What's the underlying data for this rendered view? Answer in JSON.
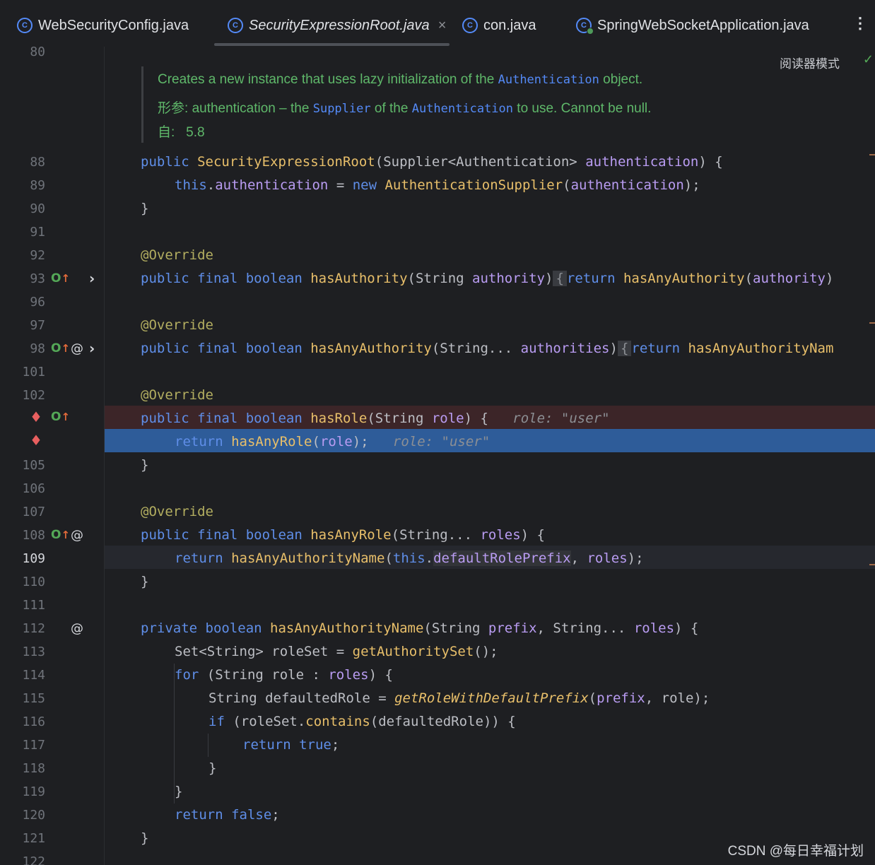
{
  "tabs": [
    {
      "label": "WebSecurityConfig.java",
      "active": false
    },
    {
      "label": "SecurityExpressionRoot.java",
      "active": true,
      "close": "×"
    },
    {
      "label": "con.java",
      "active": false
    },
    {
      "label": "SpringWebSocketApplication.java",
      "active": false
    }
  ],
  "tab_icon_letter": "C",
  "more_menu": "⋮",
  "reader_mode": "阅读器模式",
  "reader_check": "✓",
  "doc": {
    "desc_before": "Creates a new instance that uses lazy initialization of the ",
    "desc_code": "Authentication",
    "desc_after": " object.",
    "param_label": "形参:",
    "param_name": "authentication",
    "param_dash": " – the ",
    "param_code1": "Supplier",
    "param_of_the": " of the ",
    "param_code2": "Authentication",
    "param_rest": " to use. Cannot be null.",
    "since_label": "自:",
    "since_value": "5.8"
  },
  "line_numbers": {
    "n80": "80",
    "n88": "88",
    "n89": "89",
    "n90": "90",
    "n91": "91",
    "n92": "92",
    "n93": "93",
    "n96": "96",
    "n97": "97",
    "n98": "98",
    "n101": "101",
    "n102": "102",
    "n105": "105",
    "n106": "106",
    "n107": "107",
    "n108": "108",
    "n109": "109",
    "n110": "110",
    "n111": "111",
    "n112": "112",
    "n113": "113",
    "n114": "114",
    "n115": "115",
    "n116": "116",
    "n117": "117",
    "n118": "118",
    "n119": "119",
    "n120": "120",
    "n121": "121",
    "n122": "122"
  },
  "code": {
    "l88": {
      "kw": "public",
      "fn": "SecurityExpressionRoot",
      "p1": "(Supplier<Authentication> ",
      "pm": "authentication",
      "p2": ") {"
    },
    "l89": {
      "kw": "this",
      "dot": ".",
      "fd": "authentication",
      "eq": " = ",
      "kw2": "new",
      "sp": " ",
      "fn": "AuthenticationSupplier",
      "p1": "(",
      "pm": "authentication",
      "p2": ");"
    },
    "l90": "}",
    "l92": "@Override",
    "l93": {
      "kw": "public final boolean",
      "fn": "hasAuthority",
      "p1": "(String ",
      "pm": "authority",
      "p2": ")",
      "fold": "{",
      "kw2": "return",
      "fn2": "hasAnyAuthority",
      "p3": "(",
      "pm2": "authority",
      "p4": ")"
    },
    "l97": "@Override",
    "l98": {
      "kw": "public final boolean",
      "fn": "hasAnyAuthority",
      "p1": "(String... ",
      "pm": "authorities",
      "p2": ")",
      "fold": "{",
      "kw2": "return",
      "fn2": "hasAnyAuthorityNam"
    },
    "l102": "@Override",
    "l103": {
      "kw": "public final boolean",
      "fn": "hasRole",
      "p1": "(String ",
      "pm": "role",
      "p2": ") {",
      "hint": "role: \"user\""
    },
    "l104": {
      "kw": "return",
      "fn": "hasAnyRole",
      "p1": "(",
      "pm": "role",
      "p2": ");",
      "hint": "role: \"user\""
    },
    "l105": "}",
    "l107": "@Override",
    "l108": {
      "kw": "public final boolean",
      "fn": "hasAnyRole",
      "p1": "(String... ",
      "pm": "roles",
      "p2": ") {"
    },
    "l109": {
      "kw": "return",
      "fn": "hasAnyAuthorityName",
      "p1": "(",
      "kw2": "this",
      "dot": ".",
      "fd": "defaultRolePrefix",
      "comma": ", ",
      "pm": "roles",
      "p2": ");"
    },
    "l110": "}",
    "l112": {
      "kw": "private boolean",
      "fn": "hasAnyAuthorityName",
      "p1": "(String ",
      "pm": "prefix",
      "p2": ", String... ",
      "pm2": "roles",
      "p3": ") {"
    },
    "l113": {
      "p1": "Set<String> roleSet = ",
      "fn": "getAuthoritySet",
      "p2": "();"
    },
    "l114": {
      "kw": "for",
      "p1": " (String role : ",
      "pm": "roles",
      "p2": ") {"
    },
    "l115": {
      "p1": "String defaultedRole = ",
      "fn": "getRoleWithDefaultPrefix",
      "p2": "(",
      "pm": "prefix",
      "p3": ", role);"
    },
    "l116": {
      "kw": "if",
      "p1": " (roleSet.",
      "fn": "contains",
      "p2": "(defaultedRole)) {"
    },
    "l117": {
      "kw": "return true",
      "p1": ";"
    },
    "l118": "}",
    "l119": "}",
    "l120": {
      "kw": "return false",
      "p1": ";"
    },
    "l121": "}"
  },
  "gutter_icons": {
    "override": "O",
    "up": "↑",
    "at": "@",
    "fold": "›",
    "bp": "♦"
  },
  "watermark": "CSDN @每日幸福计划",
  "colors": {
    "keyword": "#5f8ee8",
    "function": "#e8bf6a",
    "param": "#b99cf2",
    "annotation": "#b3ae60",
    "doc": "#5fb86a",
    "execution_line": "#2e5c99",
    "breakpoint_line": "#3c2528"
  }
}
